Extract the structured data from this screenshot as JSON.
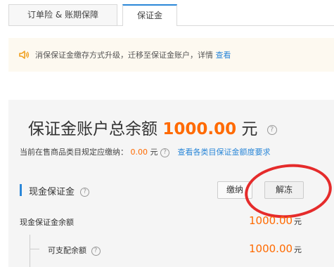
{
  "tabs": [
    {
      "label": "订单险 & 账期保障"
    },
    {
      "label": "保证金"
    }
  ],
  "notice": {
    "text": "消保保证金缴存方式升级，迁移至保证金账户，详情",
    "link": "查看"
  },
  "balance": {
    "title": "保证金账户总余额",
    "amount": "1000.00",
    "unit": "元",
    "help": "?"
  },
  "due": {
    "label": "当前在售商品类目规定应缴纳：",
    "value": "0.00",
    "unit": "元",
    "link": "查看各类目保证金额度要求"
  },
  "section": {
    "title": "现金保证金",
    "pay_button": "缴纳",
    "unfreeze_button": "解冻"
  },
  "rows": [
    {
      "label": "现金保证金余额",
      "value": "1000.00",
      "unit": "元"
    },
    {
      "label": "可支配余额",
      "value": "1000.00",
      "unit": "元"
    }
  ],
  "colors": {
    "accent": "#2b87d8",
    "amount": "#ff6a00",
    "annotation_ring": "#e52b2b"
  }
}
